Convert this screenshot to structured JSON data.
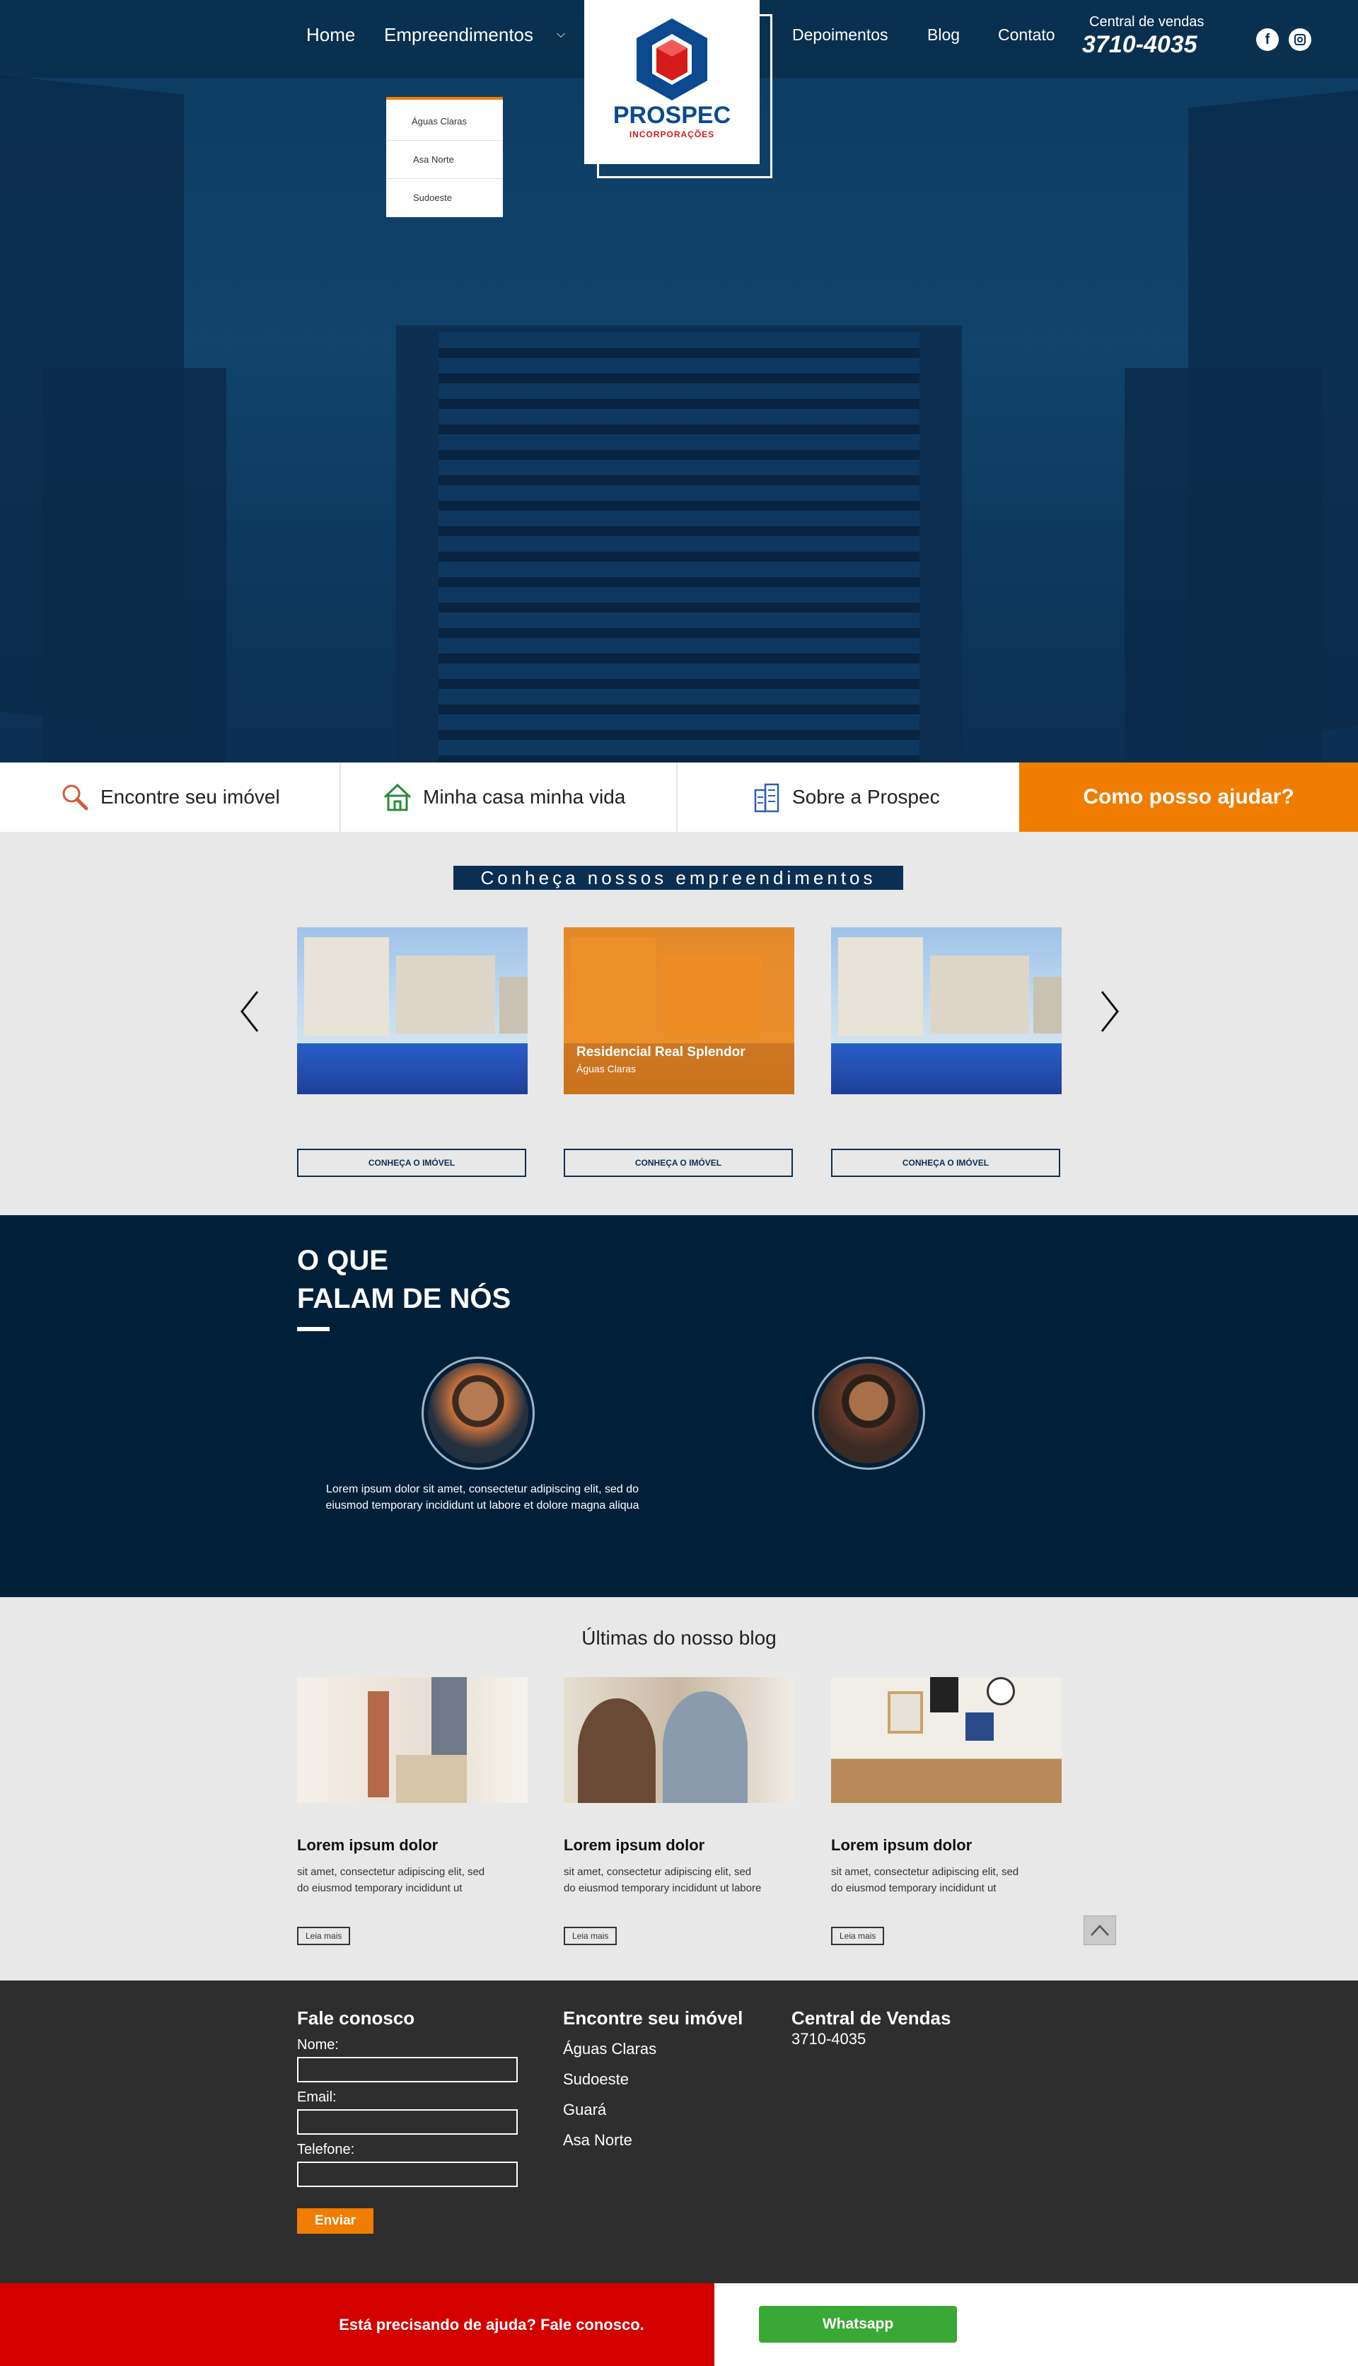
{
  "header": {
    "nav_left": [
      "Home",
      "Empreendimentos"
    ],
    "nav_right": [
      "Depoimentos",
      "Blog",
      "Contato"
    ],
    "sales_label": "Central de vendas",
    "sales_phone": "3710-4035",
    "logo_name": "PROSPEC",
    "logo_sub": "INCORPORAÇÕES",
    "social": [
      "facebook-icon",
      "instagram-icon"
    ],
    "dropdown": [
      "Águas Claras",
      "Asa Norte",
      "Sudoeste"
    ]
  },
  "features": {
    "items": [
      "Encontre seu imóvel",
      "Minha casa minha vida",
      "Sobre a Prospec"
    ],
    "help": "Como posso ajudar?"
  },
  "properties": {
    "title": "Conheça nossos empreendimentos",
    "cards": [
      {
        "title": "",
        "sub": "",
        "button": "CONHEÇA O IMÓVEL"
      },
      {
        "title": "Residencial Real Splendor",
        "sub": "Águas Claras",
        "button": "CONHEÇA O IMÓVEL"
      },
      {
        "title": "",
        "sub": "",
        "button": "CONHEÇA O IMÓVEL"
      }
    ]
  },
  "testimonials": {
    "title_line1": "O QUE",
    "title_line2": "FALAM DE NÓS",
    "text": "Lorem ipsum dolor sit amet, consectetur adipiscing elit, sed do eiusmod temporary incididunt ut labore et dolore magna aliqua"
  },
  "blog": {
    "title": "Últimas do nosso blog",
    "posts": [
      {
        "title": "Lorem ipsum dolor",
        "text": "sit amet, consectetur adipiscing elit, sed do eiusmod temporary incididunt ut",
        "button": "Leia mais"
      },
      {
        "title": "Lorem ipsum dolor",
        "text": "sit amet, consectetur adipiscing elit, sed do eiusmod temporary incididunt ut labore",
        "button": "Leia mais"
      },
      {
        "title": "Lorem ipsum dolor",
        "text": "sit amet, consectetur adipiscing elit, sed do eiusmod temporary incididunt ut",
        "button": "Leia mais"
      }
    ]
  },
  "footer": {
    "contact_title": "Fale conosco",
    "name_label": "Nome:",
    "email_label": "Email:",
    "phone_label": "Telefone:",
    "send": "Enviar",
    "find_title": "Encontre seu imóvel",
    "find_links": [
      "Águas Claras",
      "Sudoeste",
      "Guará",
      "Asa Norte"
    ],
    "sales_title": "Central de Vendas",
    "sales_phone": "3710-4035"
  },
  "bottom": {
    "help": "Está precisando de ajuda? Fale conosco.",
    "whatsapp": "Whatsapp"
  },
  "colors": {
    "navy": "#0b2f52",
    "orange": "#f07c00",
    "red": "#d40000",
    "green": "#3aa834"
  }
}
